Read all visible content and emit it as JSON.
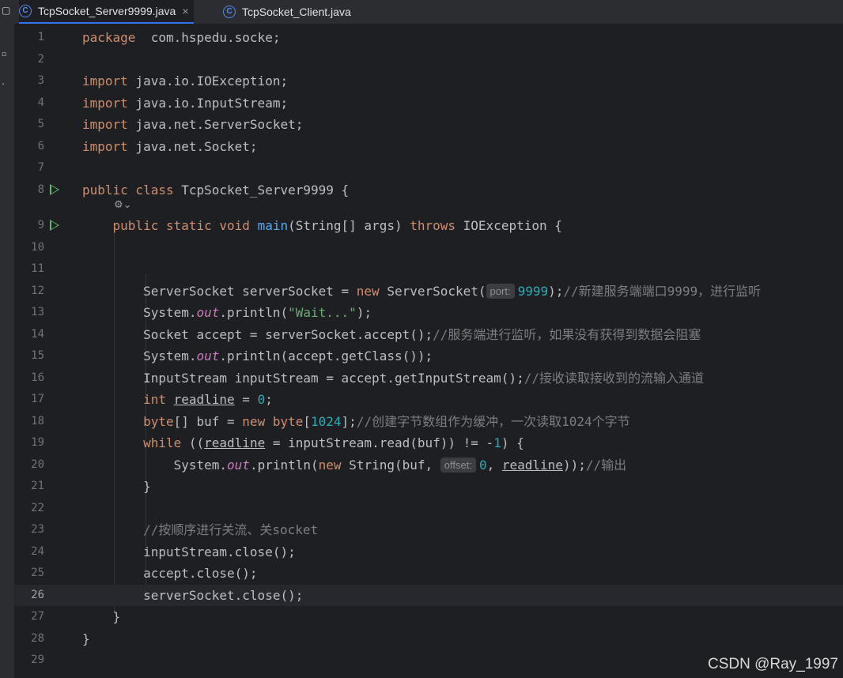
{
  "tabs": [
    {
      "label": "TcpSocket_Server9999.java",
      "icon": "class-c-icon",
      "active": true,
      "close": "×"
    },
    {
      "label": "TcpSocket_Client.java",
      "icon": "class-c-icon",
      "active": false
    }
  ],
  "current_line": "26",
  "watermark": "CSDN @Ray_1997",
  "lines": [
    {
      "n": "1",
      "segs": [
        [
          "kw",
          "package"
        ],
        [
          "",
          "  com.hspedu.socke;"
        ]
      ]
    },
    {
      "n": "2",
      "segs": []
    },
    {
      "n": "3",
      "segs": [
        [
          "kw",
          "import"
        ],
        [
          "",
          " java.io.IOException;"
        ]
      ]
    },
    {
      "n": "4",
      "segs": [
        [
          "kw",
          "import"
        ],
        [
          "",
          " java.io.InputStream;"
        ]
      ]
    },
    {
      "n": "5",
      "segs": [
        [
          "kw",
          "import"
        ],
        [
          "",
          " java.net.ServerSocket;"
        ]
      ]
    },
    {
      "n": "6",
      "segs": [
        [
          "kw",
          "import"
        ],
        [
          "",
          " java.net.Socket;"
        ]
      ]
    },
    {
      "n": "7",
      "segs": []
    },
    {
      "n": "8",
      "run": true,
      "segs": [
        [
          "kw",
          "public class"
        ],
        [
          "",
          " TcpSocket_Server9999 {"
        ]
      ]
    },
    {
      "n": "9",
      "run": true,
      "segs": [
        [
          "",
          "    "
        ],
        [
          "kw",
          "public static void"
        ],
        [
          "",
          " "
        ],
        [
          "fn",
          "main"
        ],
        [
          "",
          "(String[] args) "
        ],
        [
          "kw",
          "throws"
        ],
        [
          "",
          " IOException {"
        ]
      ]
    },
    {
      "n": "10",
      "segs": []
    },
    {
      "n": "11",
      "segs": []
    },
    {
      "n": "12",
      "segs": [
        [
          "",
          "        ServerSocket serverSocket = "
        ],
        [
          "kw",
          "new"
        ],
        [
          "",
          " ServerSocket("
        ],
        [
          "hint",
          "port:"
        ],
        [
          "num",
          "9999"
        ],
        [
          "",
          ");"
        ],
        [
          "cm",
          "//新建服务端端口9999，进行监听"
        ]
      ]
    },
    {
      "n": "13",
      "segs": [
        [
          "",
          "        System."
        ],
        [
          "fld",
          "out"
        ],
        [
          "",
          ".println("
        ],
        [
          "str",
          "\"Wait...\""
        ],
        [
          "",
          ");"
        ]
      ]
    },
    {
      "n": "14",
      "segs": [
        [
          "",
          "        Socket accept = serverSocket.accept();"
        ],
        [
          "cm",
          "//服务端进行监听，如果没有获得到数据会阻塞"
        ]
      ]
    },
    {
      "n": "15",
      "segs": [
        [
          "",
          "        System."
        ],
        [
          "fld",
          "out"
        ],
        [
          "",
          ".println(accept.getClass());"
        ]
      ]
    },
    {
      "n": "16",
      "segs": [
        [
          "",
          "        InputStream inputStream = accept.getInputStream();"
        ],
        [
          "cm",
          "//接收读取接收到的流输入通道"
        ]
      ]
    },
    {
      "n": "17",
      "segs": [
        [
          "",
          "        "
        ],
        [
          "kw",
          "int"
        ],
        [
          "",
          " "
        ],
        [
          "ul",
          "readline"
        ],
        [
          "",
          " = "
        ],
        [
          "num",
          "0"
        ],
        [
          "",
          ";"
        ]
      ]
    },
    {
      "n": "18",
      "segs": [
        [
          "",
          "        "
        ],
        [
          "kw",
          "byte"
        ],
        [
          "",
          "[] buf = "
        ],
        [
          "kw",
          "new"
        ],
        [
          "",
          " "
        ],
        [
          "kw",
          "byte"
        ],
        [
          "",
          "["
        ],
        [
          "num",
          "1024"
        ],
        [
          "",
          "];"
        ],
        [
          "cm",
          "//创建字节数组作为缓冲，一次读取1024个字节"
        ]
      ]
    },
    {
      "n": "19",
      "segs": [
        [
          "",
          "        "
        ],
        [
          "kw",
          "while"
        ],
        [
          "",
          " (("
        ],
        [
          "ul",
          "readline"
        ],
        [
          "",
          " = inputStream.read(buf)) != -"
        ],
        [
          "num",
          "1"
        ],
        [
          "",
          ") {"
        ]
      ]
    },
    {
      "n": "20",
      "segs": [
        [
          "",
          "            System."
        ],
        [
          "fld",
          "out"
        ],
        [
          "",
          ".println("
        ],
        [
          "kw",
          "new"
        ],
        [
          "",
          " String(buf, "
        ],
        [
          "hint",
          "offset:"
        ],
        [
          "num",
          "0"
        ],
        [
          "",
          ", "
        ],
        [
          "ul",
          "readline"
        ],
        [
          "",
          "));"
        ],
        [
          "cm",
          "//输出"
        ]
      ]
    },
    {
      "n": "21",
      "segs": [
        [
          "",
          "        }"
        ]
      ]
    },
    {
      "n": "22",
      "segs": []
    },
    {
      "n": "23",
      "segs": [
        [
          "",
          "        "
        ],
        [
          "cm",
          "//按顺序进行关流、关socket"
        ]
      ]
    },
    {
      "n": "24",
      "segs": [
        [
          "",
          "        inputStream.close();"
        ]
      ]
    },
    {
      "n": "25",
      "segs": [
        [
          "",
          "        accept.close();"
        ]
      ]
    },
    {
      "n": "26",
      "segs": [
        [
          "",
          "        serverSocket.close();"
        ]
      ]
    },
    {
      "n": "27",
      "segs": [
        [
          "",
          "    }"
        ]
      ]
    },
    {
      "n": "28",
      "segs": [
        [
          "",
          "}"
        ]
      ]
    },
    {
      "n": "29",
      "segs": []
    }
  ]
}
